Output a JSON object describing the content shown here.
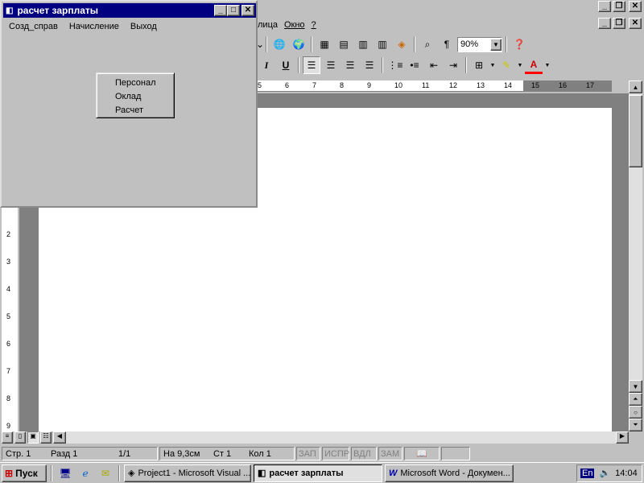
{
  "form": {
    "title": "расчет зарплаты",
    "menu": [
      "Созд_справ",
      "Начисление",
      "Выход"
    ],
    "popup": [
      "Персонал",
      "Оклад",
      "Расчет"
    ]
  },
  "word": {
    "menu": [
      "лица",
      "Окно",
      "?"
    ],
    "zoom": "90%",
    "ruler_h": [
      "5",
      "6",
      "7",
      "8",
      "9",
      "10",
      "11",
      "12",
      "13",
      "14",
      "15",
      "16",
      "17"
    ],
    "ruler_v": [
      "2",
      "3",
      "4",
      "5",
      "6",
      "7",
      "8",
      "9"
    ],
    "status": {
      "page": "Стр. 1",
      "section": "Разд 1",
      "pages": "1/1",
      "pos": "На 9,3см",
      "line": "Ст 1",
      "col": "Кол 1",
      "rec": "ЗАП",
      "trk": "ИСПР",
      "ext": "ВДЛ",
      "ovr": "ЗАМ"
    }
  },
  "taskbar": {
    "start": "Пуск",
    "tasks": [
      "Project1 - Microsoft Visual ...",
      "расчет зарплаты",
      "Microsoft Word - Докумен..."
    ],
    "lang": "En",
    "clock": "14:04"
  }
}
